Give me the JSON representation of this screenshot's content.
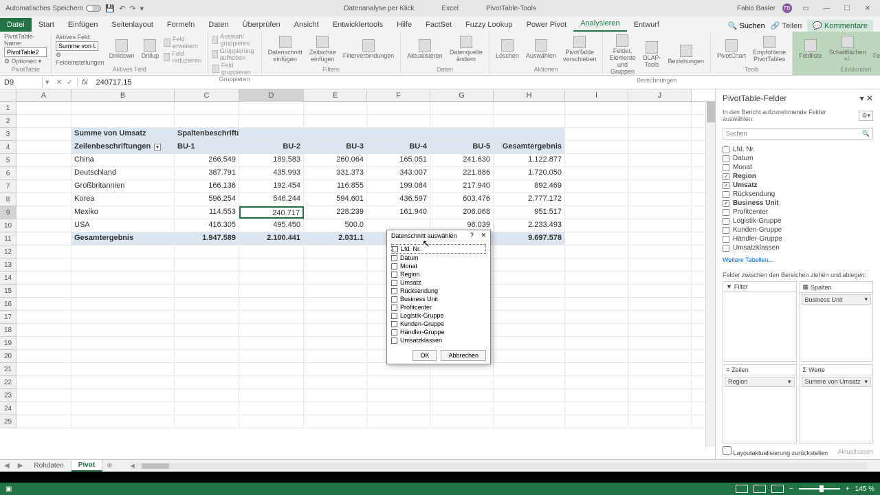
{
  "title": {
    "autoSave": "Automatisches Speichern",
    "docName": "Datenanalyse per Klick",
    "appName": "Excel",
    "contextTab": "PivotTable-Tools",
    "userName": "Fabio Basler",
    "userInitials": "FB"
  },
  "tabs": {
    "items": [
      "Datei",
      "Start",
      "Einfügen",
      "Seitenlayout",
      "Formeln",
      "Daten",
      "Überprüfen",
      "Ansicht",
      "Entwicklertools",
      "Hilfe",
      "FactSet",
      "Fuzzy Lookup",
      "Power Pivot",
      "Analysieren",
      "Entwurf"
    ],
    "active": "Analysieren",
    "searchLabel": "Suchen",
    "shareLabel": "Teilen",
    "commentsLabel": "Kommentare"
  },
  "ribbon": {
    "pivotNameLabel": "PivotTable-Name:",
    "pivotName": "PivotTable2",
    "optionsLabel": "Optionen",
    "pivotGroupLabel": "PivotTable",
    "activeFieldLabel": "Aktives Feld:",
    "activeField": "Summe von Ums",
    "fieldSettings": "Feldeinstellungen",
    "drilldown": "Drilldown",
    "drillup": "Drillup",
    "expandField": "Feld erweitern",
    "collapseField": "Feld reduzieren",
    "activeFieldGroup": "Aktives Feld",
    "groupSel": "Auswahl gruppieren",
    "ungroupSel": "Gruppierung aufheben",
    "groupField": "Feld gruppieren",
    "groupLabel": "Gruppieren",
    "slicer": "Datenschnitt einfügen",
    "timeline": "Zeitachse einfügen",
    "filterConn": "Filterverbindungen",
    "filterLabel": "Filtern",
    "refresh": "Aktualisieren",
    "changeSource": "Datenquelle ändern",
    "dataLabel": "Daten",
    "clear": "Löschen",
    "select": "Auswählen",
    "move": "PivotTable verschieben",
    "actionsLabel": "Aktionen",
    "fieldsItems": "Felder, Elemente und Gruppen",
    "olap": "OLAP-Tools",
    "relations": "Beziehungen",
    "calcLabel": "Berechnungen",
    "pivotChart": "PivotChart",
    "recommended": "Empfohlene PivotTables",
    "toolsLabel": "Tools",
    "fieldList": "Feldliste",
    "buttons": "Schaltflächen +/-",
    "headers": "Feldkopfzeilen",
    "showLabel": "Einblenden"
  },
  "formula": {
    "nameBox": "D9",
    "value": "240717,15"
  },
  "cols": [
    "A",
    "B",
    "C",
    "D",
    "E",
    "F",
    "G",
    "H",
    "I",
    "J"
  ],
  "pivot": {
    "measure": "Summe von Umsatz",
    "colLabel": "Spaltenbeschriftungen",
    "rowLabel": "Zeilenbeschriftungen",
    "buHeaders": [
      "BU-1",
      "BU-2",
      "BU-3",
      "BU-4",
      "BU-5"
    ],
    "totalHeader": "Gesamtergebnis",
    "rows": [
      {
        "label": "China",
        "vals": [
          "266.549",
          "189.583",
          "260.064",
          "165.051",
          "241.630"
        ],
        "total": "1.122.877"
      },
      {
        "label": "Deutschland",
        "vals": [
          "387.791",
          "435.993",
          "331.373",
          "343.007",
          "221.886"
        ],
        "total": "1.720.050"
      },
      {
        "label": "Großbritannien",
        "vals": [
          "166.136",
          "192.454",
          "116.855",
          "199.084",
          "217.940"
        ],
        "total": "892.469"
      },
      {
        "label": "Korea",
        "vals": [
          "596.254",
          "546.244",
          "594.601",
          "436.597",
          "603.476"
        ],
        "total": "2.777.172"
      },
      {
        "label": "Mexiko",
        "vals": [
          "114.553",
          "240.717",
          "228.239",
          "161.940",
          "206.068"
        ],
        "total": "951.517"
      },
      {
        "label": "USA",
        "vals": [
          "416.305",
          "495.450",
          "500.0",
          "",
          "96.039"
        ],
        "total": "2.233.493"
      }
    ],
    "grandLabel": "Gesamtergebnis",
    "grandVals": [
      "1.947.589",
      "2.100.441",
      "2.031.1",
      "",
      "87.039"
    ],
    "grandTotal": "9.697.578"
  },
  "dialog": {
    "title": "Datenschnitt auswählen",
    "items": [
      "Lfd. Nr.",
      "Datum",
      "Monat",
      "Region",
      "Umsatz",
      "Rücksendung",
      "Business Unit",
      "Profitcenter",
      "Logistik-Gruppe",
      "Kunden-Gruppe",
      "Händler-Gruppe",
      "Umsatzklassen"
    ],
    "ok": "OK",
    "cancel": "Abbrechen"
  },
  "fieldPane": {
    "title": "PivotTable-Felder",
    "subtitle": "In den Bericht aufzunehmende Felder auswählen:",
    "searchPlaceholder": "Suchen",
    "fields": [
      {
        "name": "Lfd. Nr.",
        "checked": false
      },
      {
        "name": "Datum",
        "checked": false
      },
      {
        "name": "Monat",
        "checked": false
      },
      {
        "name": "Region",
        "checked": true
      },
      {
        "name": "Umsatz",
        "checked": true
      },
      {
        "name": "Rücksendung",
        "checked": false
      },
      {
        "name": "Business Unit",
        "checked": true
      },
      {
        "name": "Profitcenter",
        "checked": false
      },
      {
        "name": "Logistik-Gruppe",
        "checked": false
      },
      {
        "name": "Kunden-Gruppe",
        "checked": false
      },
      {
        "name": "Händler-Gruppe",
        "checked": false
      },
      {
        "name": "Umsatzklassen",
        "checked": false
      }
    ],
    "moreTables": "Weitere Tabellen...",
    "dragLabel": "Felder zwischen den Bereichen ziehen und ablegen:",
    "filterLabel": "Filter",
    "columnsLabel": "Spalten",
    "rowsLabel": "Zeilen",
    "valuesLabel": "Werte",
    "colField": "Business Unit",
    "rowField": "Region",
    "valField": "Summe von Umsatz",
    "deferLabel": "Layoutaktualisierung zurückstellen",
    "updateLabel": "Aktualisieren"
  },
  "sheets": {
    "items": [
      "Rohdaten",
      "Pivot"
    ],
    "active": "Pivot"
  },
  "status": {
    "zoom": "145 %"
  }
}
